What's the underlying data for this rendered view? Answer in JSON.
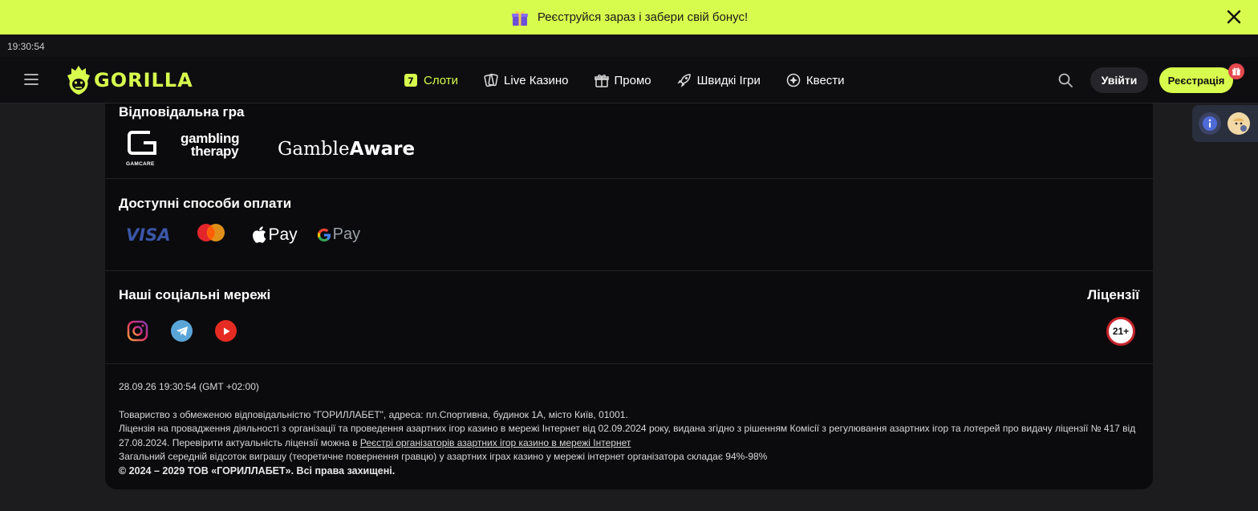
{
  "promo_bar": {
    "text": "Реєструйся зараз і забери свій бонус!"
  },
  "clock": {
    "time": "19:30:54"
  },
  "header": {
    "logo_text": "GORILLA",
    "nav": [
      {
        "label": "Слоти",
        "icon": "slot-7-icon",
        "active": true
      },
      {
        "label": "Live Казино",
        "icon": "cards-icon"
      },
      {
        "label": "Промо",
        "icon": "gift-icon"
      },
      {
        "label": "Швидкі Ігри",
        "icon": "rocket-icon"
      },
      {
        "label": "Квести",
        "icon": "compass-icon"
      }
    ],
    "login_label": "Увійти",
    "register_label": "Реєстрація"
  },
  "footer": {
    "responsible_title": "Відповідальна гра",
    "responsible_logos": {
      "gamcare": "GAMCARE",
      "gambling_therapy_1": "gambling",
      "gambling_therapy_2": "therapy",
      "gambleaware_1": "Gamble",
      "gambleaware_2": "Aware"
    },
    "payments_title": "Доступні способи оплати",
    "payments": {
      "visa": "VISA",
      "apple_pay": "Pay",
      "google_pay": "Pay"
    },
    "social_title": "Наші соціальні мережі",
    "licenses_title": "Ліцензії",
    "age_badge": "21+",
    "legal": {
      "datetime": "28.09.26 19:30:54 (GMT +02:00)",
      "company": "Товариство з обмеженою відповідальністю \"ГОРИЛЛАБЕТ\", адреса: пл.Спортивна, будинок 1А, місто Київ, 01001.",
      "license_part1": "Ліцензія на провадження діяльності з організації та проведення азартних ігор казино в мережі Інтернет від 02.09.2024 року, видана згідно з рішенням Комісії з регулювання азартних ігор та лотерей про видачу ліцензії № 417 від 27.08.2024. Перевірити актуальність ліцензії можна в ",
      "license_link": "Реєстрі організаторів азартних ігор казино в мережі Інтернет",
      "rtp": "Загальний середній відсоток виграшу (теоретичне повернення гравцю) у азартних іграх казино у мережі інтернет організатора складає 94%-98%",
      "copyright": "© 2024 – 2029 ТОВ «ГОРИЛЛАБЕТ». Всі права захищені."
    }
  },
  "colors": {
    "accent": "#d8fc4d",
    "background": "#1c1c1f",
    "card": "#0b0b0d",
    "badge_red": "#c8242b"
  }
}
